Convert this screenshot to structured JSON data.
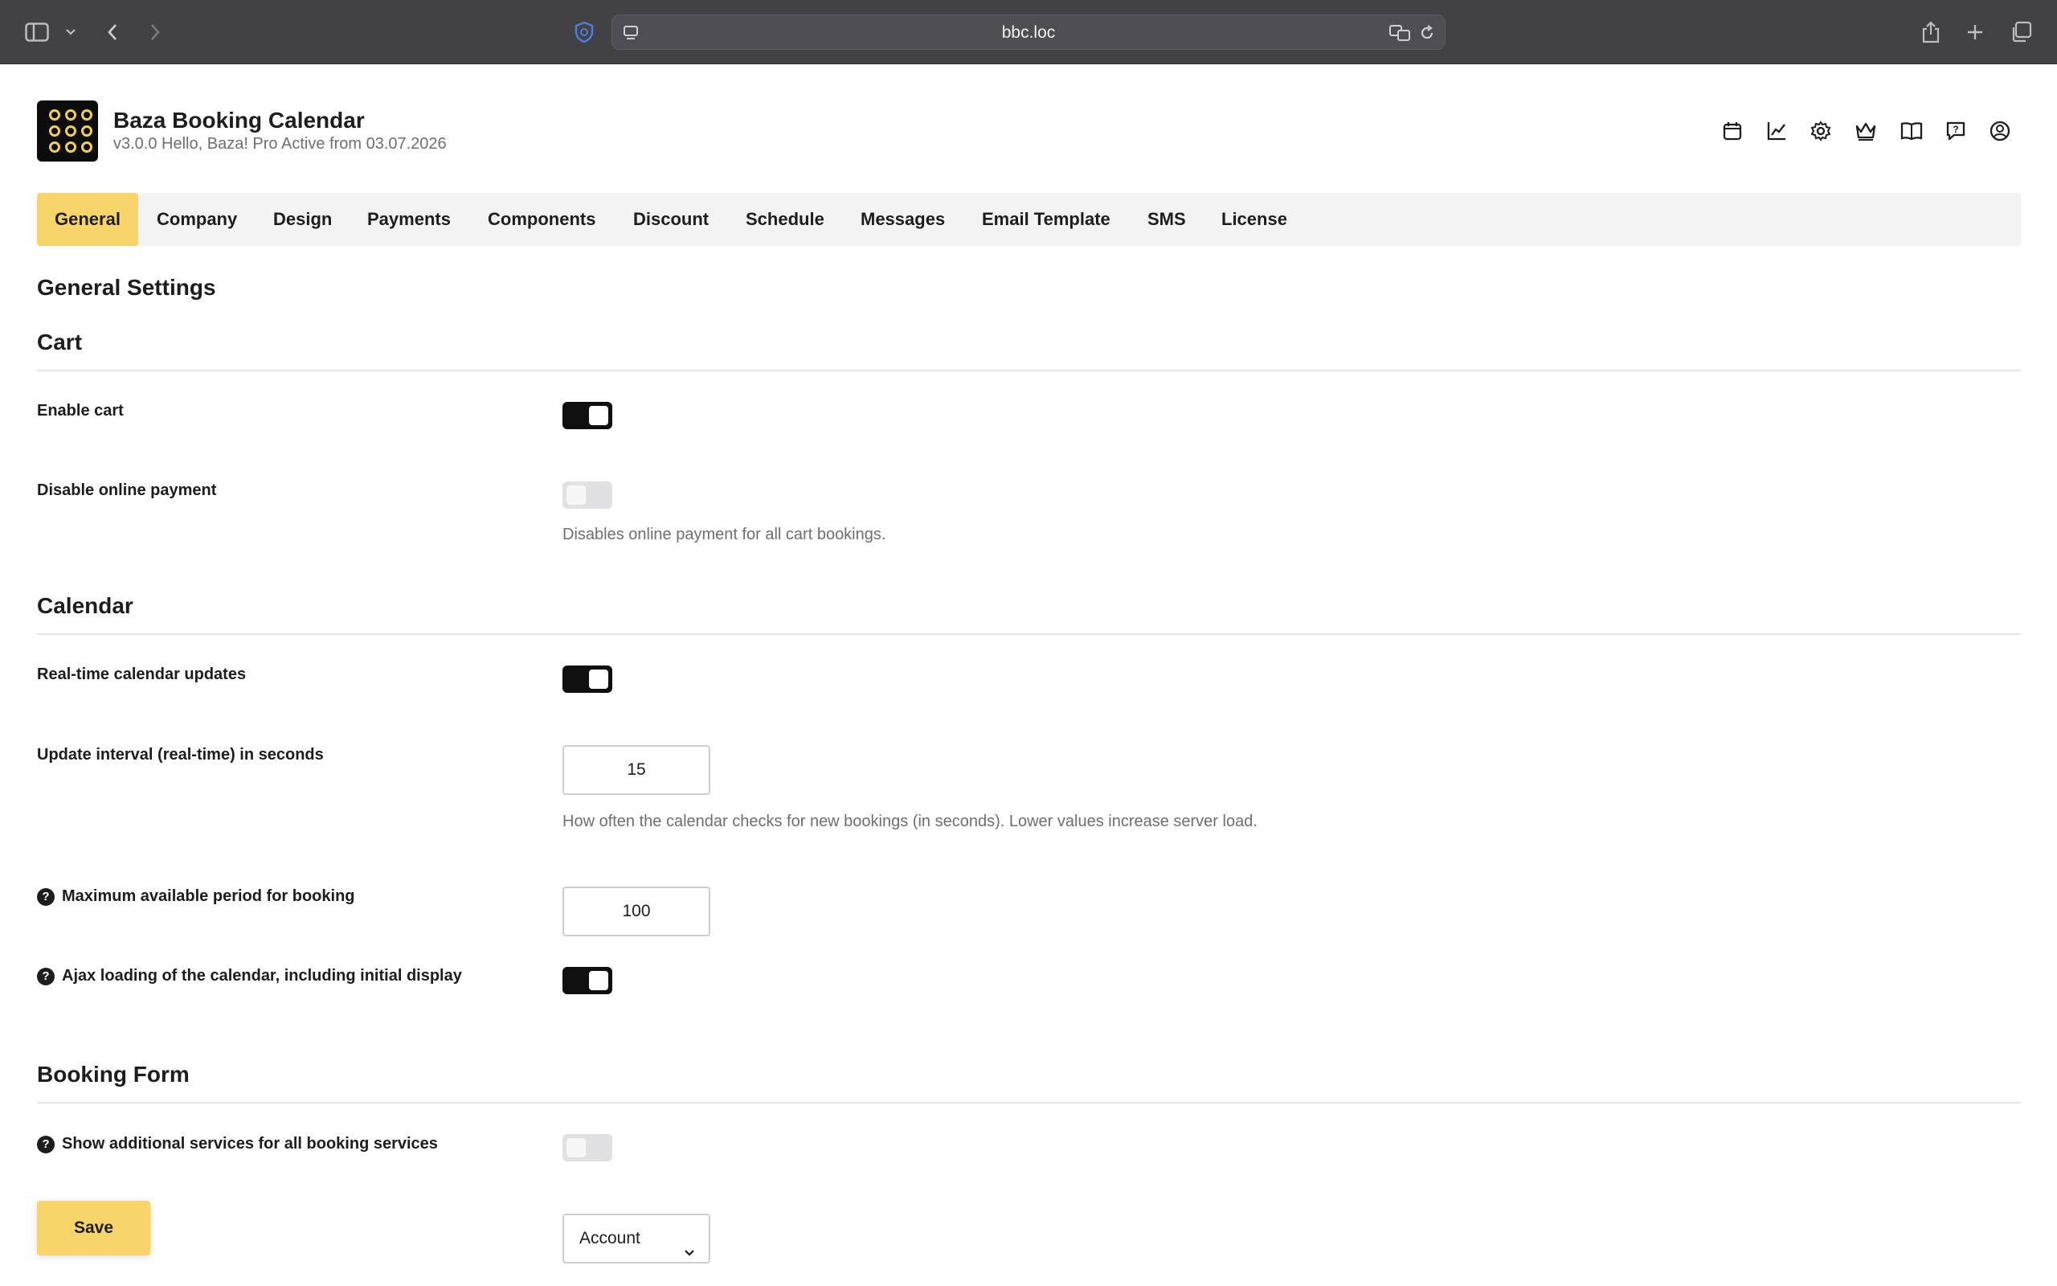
{
  "browser": {
    "url": "bbc.loc"
  },
  "app": {
    "title": "Baza Booking Calendar",
    "subtitle": "v3.0.0 Hello, Baza! Pro Active from 03.07.2026",
    "header_icons": [
      "calendar-icon",
      "chart-icon",
      "gear-icon",
      "crown-icon",
      "book-icon",
      "help-chat-icon",
      "user-icon"
    ]
  },
  "tabs": [
    {
      "label": "General",
      "active": true
    },
    {
      "label": "Company",
      "active": false
    },
    {
      "label": "Design",
      "active": false
    },
    {
      "label": "Payments",
      "active": false
    },
    {
      "label": "Components",
      "active": false
    },
    {
      "label": "Discount",
      "active": false
    },
    {
      "label": "Schedule",
      "active": false
    },
    {
      "label": "Messages",
      "active": false
    },
    {
      "label": "Email Template",
      "active": false
    },
    {
      "label": "SMS",
      "active": false
    },
    {
      "label": "License",
      "active": false
    }
  ],
  "page_title": "General Settings",
  "sections": {
    "cart": {
      "heading": "Cart",
      "enable_cart": {
        "label": "Enable cart",
        "on": true
      },
      "disable_online_payment": {
        "label": "Disable online payment",
        "on": false,
        "help": "Disables online payment for all cart bookings."
      }
    },
    "calendar": {
      "heading": "Calendar",
      "realtime_updates": {
        "label": "Real-time calendar updates",
        "on": true
      },
      "update_interval": {
        "label": "Update interval (real-time) in seconds",
        "value": "15",
        "help": "How often the calendar checks for new bookings (in seconds). Lower values increase server load."
      },
      "max_period": {
        "label": "Maximum available period for booking",
        "value": "100"
      },
      "ajax_loading": {
        "label": "Ajax loading of the calendar, including initial display",
        "on": true
      }
    },
    "booking_form": {
      "heading": "Booking Form",
      "additional_services": {
        "label": "Show additional services for all booking services",
        "on": false
      },
      "select_value": "Account"
    }
  },
  "save_label": "Save",
  "colors": {
    "accent": "#f8d56b",
    "toggle_on": "#0f0f10",
    "toggle_off": "#e1e1e3"
  }
}
